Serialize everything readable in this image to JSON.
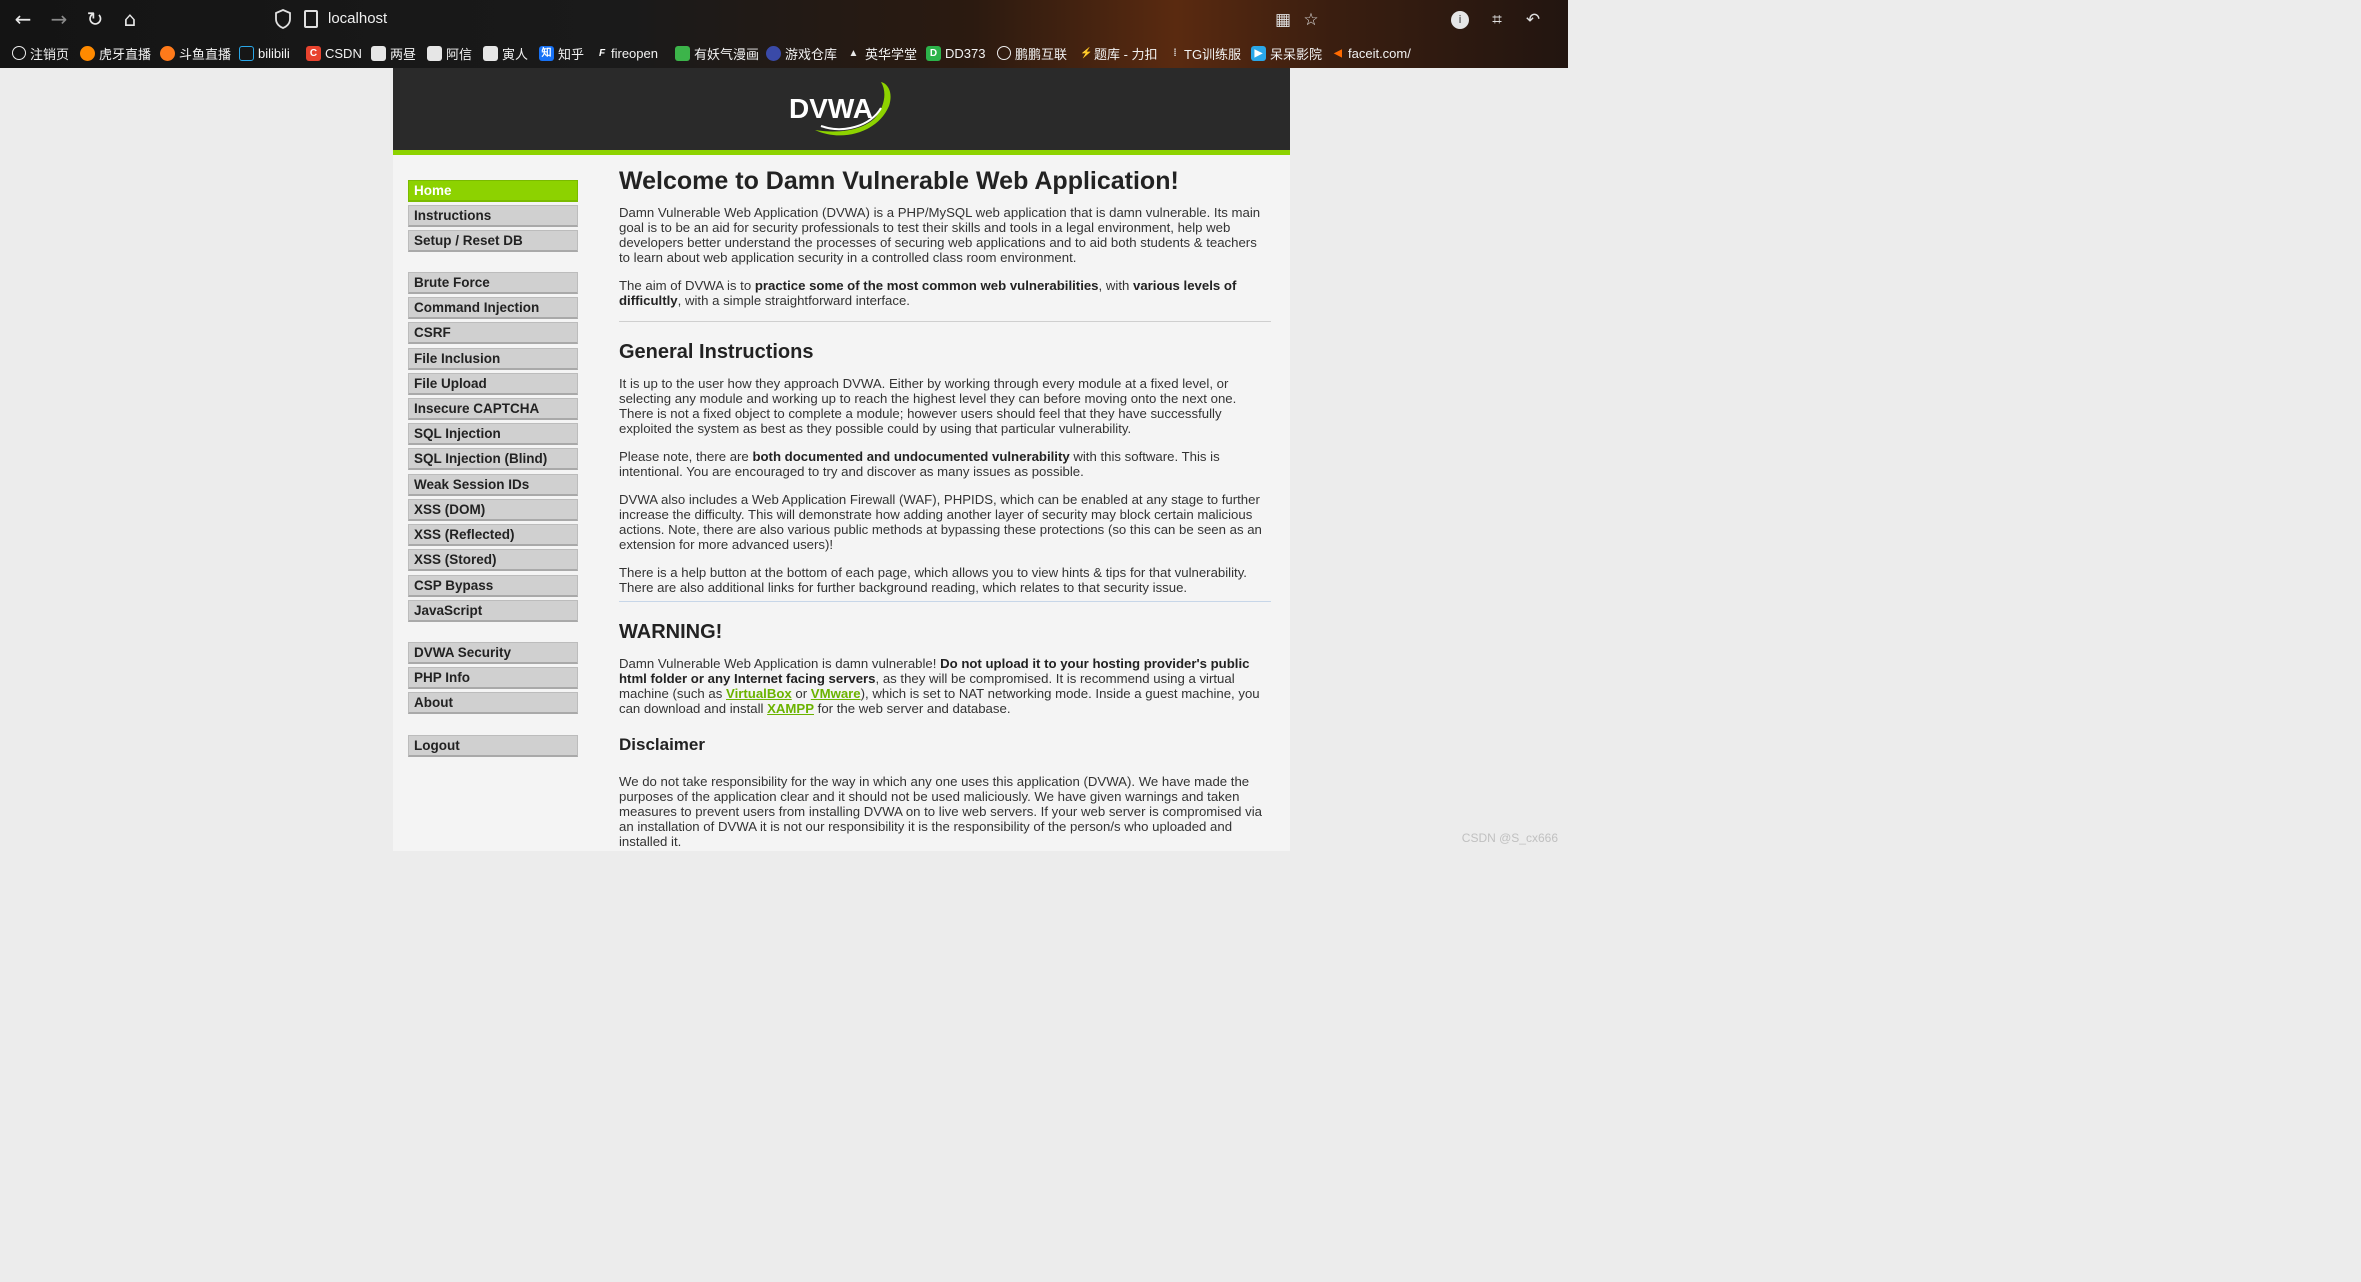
{
  "browser": {
    "url": "localhost",
    "bookmarks": [
      "注销页",
      "虎牙直播",
      "斗鱼直播",
      "bilibili",
      "CSDN",
      "两昼",
      "阿信",
      "寅人",
      "知乎",
      "fireopen",
      "有妖气漫画",
      "游戏仓库",
      "英华学堂",
      "DD373",
      "鹏鹏互联",
      "题库 - 力扣",
      "TG训练服",
      "呆呆影院",
      "faceit.com/"
    ]
  },
  "header": {
    "logo_text": "DVWA"
  },
  "menu": {
    "home": "Home",
    "instructions": "Instructions",
    "setup": "Setup / Reset DB",
    "brute_force": "Brute Force",
    "command_injection": "Command Injection",
    "csrf": "CSRF",
    "file_inclusion": "File Inclusion",
    "file_upload": "File Upload",
    "insecure_captcha": "Insecure CAPTCHA",
    "sql_injection": "SQL Injection",
    "sql_injection_blind": "SQL Injection (Blind)",
    "weak_session_ids": "Weak Session IDs",
    "xss_dom": "XSS (DOM)",
    "xss_reflected": "XSS (Reflected)",
    "xss_stored": "XSS (Stored)",
    "csp_bypass": "CSP Bypass",
    "javascript": "JavaScript",
    "dvwa_security": "DVWA Security",
    "php_info": "PHP Info",
    "about": "About",
    "logout": "Logout"
  },
  "main": {
    "title": "Welcome to Damn Vulnerable Web Application!",
    "intro": "Damn Vulnerable Web Application (DVWA) is a PHP/MySQL web application that is damn vulnerable. Its main goal is to be an aid for security professionals to test their skills and tools in a legal environment, help web developers better understand the processes of securing web applications and to aid both students & teachers to learn about web application security in a controlled class room environment.",
    "aim_1": "The aim of DVWA is to ",
    "aim_bold_1": "practice some of the most common web vulnerabilities",
    "aim_2": ", with ",
    "aim_bold_2": "various levels of difficultly",
    "aim_3": ", with a simple straightforward interface.",
    "general_title": "General Instructions",
    "general_p1": "It is up to the user how they approach DVWA. Either by working through every module at a fixed level, or selecting any module and working up to reach the highest level they can before moving onto the next one. There is not a fixed object to complete a module; however users should feel that they have successfully exploited the system as best as they possible could by using that particular vulnerability.",
    "note_1": "Please note, there are ",
    "note_bold": "both documented and undocumented vulnerability",
    "note_2": " with this software. This is intentional. You are encouraged to try and discover as many issues as possible.",
    "waf_p": "DVWA also includes a Web Application Firewall (WAF), PHPIDS, which can be enabled at any stage to further increase the difficulty. This will demonstrate how adding another layer of security may block certain malicious actions. Note, there are also various public methods at bypassing these protections (so this can be seen as an extension for more advanced users)!",
    "help_p": "There is a help button at the bottom of each page, which allows you to view hints & tips for that vulnerability. There are also additional links for further background reading, which relates to that security issue.",
    "warning_title": "WARNING!",
    "warn_1": "Damn Vulnerable Web Application is damn vulnerable! ",
    "warn_bold": "Do not upload it to your hosting provider's public html folder or any Internet facing servers",
    "warn_2": ", as they will be compromised. It is recommend using a virtual machine (such as ",
    "link_virtualbox": "VirtualBox",
    "warn_or": " or ",
    "link_vmware": "VMware",
    "warn_3": "), which is set to NAT networking mode. Inside a guest machine, you can download and install ",
    "link_xampp": "XAMPP",
    "warn_4": " for the web server and database.",
    "disclaimer_title": "Disclaimer",
    "disclaimer_p": "We do not take responsibility for the way in which any one uses this application (DVWA). We have made the purposes of the application clear and it should not be used maliciously. We have given warnings and taken measures to prevent users from installing DVWA on to live web servers. If your web server is compromised via an installation of DVWA it is not our responsibility it is the responsibility of the person/s who uploaded and installed it."
  },
  "watermark": "CSDN @S_cx666"
}
